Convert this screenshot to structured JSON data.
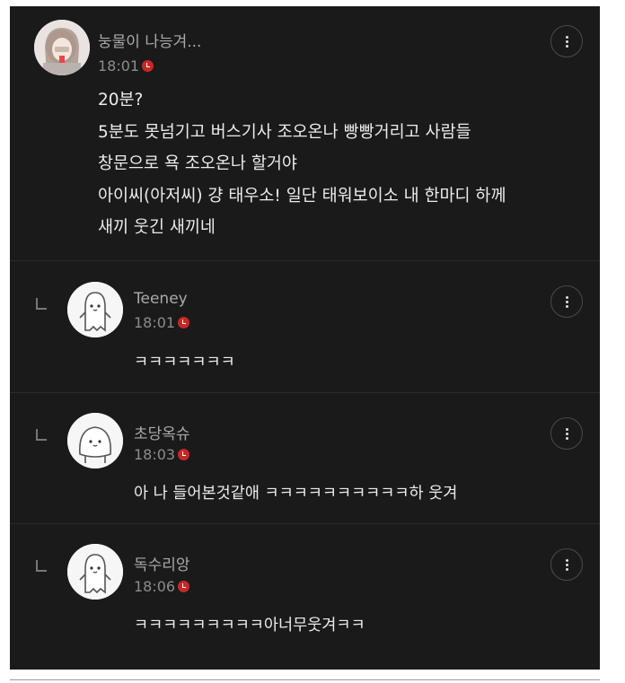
{
  "main_post": {
    "author": "눙물이 나능겨...",
    "time": "18:01",
    "lines": [
      "20분?",
      "5분도 못넘기고 버스기사 조오온나 빵빵거리고 사람들",
      "창문으로 욕 조오온나 할거야",
      "아이씨(아저씨) 걍 태우소! 일단 태워보이소 내 한마디 하께",
      "새끼 웃긴 새끼네"
    ]
  },
  "replies": [
    {
      "author": "Teeney",
      "time": "18:01",
      "text": "ㅋㅋㅋㅋㅋㅋㅋ"
    },
    {
      "author": "초당옥슈",
      "time": "18:03",
      "text": "아 나 들어본것같애 ㅋㅋㅋㅋㅋㅋㅋㅋㅋㅋ하 웃겨"
    },
    {
      "author": "독수리앙",
      "time": "18:06",
      "text": "ㅋㅋㅋㅋㅋㅋㅋㅋㅋ아너무웃겨ㅋㅋ"
    }
  ],
  "icons": {
    "more": "more-vertical-icon",
    "reply": "reply-arrow-icon",
    "clock": "clock-icon"
  },
  "colors": {
    "background": "#1a1a1a",
    "text": "#ececec",
    "meta": "#a9a9a9",
    "time_badge": "#c62828"
  }
}
